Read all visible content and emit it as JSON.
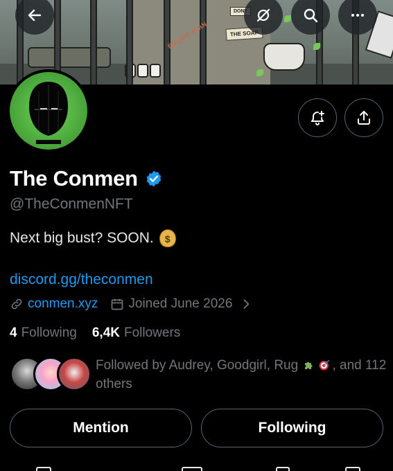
{
  "profile": {
    "name": "The Conmen",
    "handle": "@TheConmenNFT",
    "bio": "Next big bust? SOON.",
    "bio_emoji": "$",
    "link": "discord.gg/theconmen",
    "website": "conmen.xyz",
    "joined": "Joined June 2026",
    "following_count": "4",
    "following_label": "Following",
    "followers_count": "6,4K",
    "followers_label": "Followers",
    "followed_by_prefix": "Followed by Audrey, Goodgirl, Rug",
    "followed_by_suffix": ", and 112 others"
  },
  "banner": {
    "sign_soap": "THE SOAP",
    "sign_dont": "DONT",
    "escape": "ESCAPE PLAN"
  },
  "buttons": {
    "mention": "Mention",
    "following": "Following"
  },
  "icons": [
    "back-arrow-icon",
    "no-translate-icon",
    "search-icon",
    "more-icon",
    "bell-plus-icon",
    "share-icon",
    "verified-badge-icon",
    "link-icon",
    "calendar-icon",
    "chevron-right-icon"
  ],
  "colors": {
    "accent": "#1d9bf0",
    "muted": "#71767b",
    "avatar_green": "#5dc04b"
  }
}
